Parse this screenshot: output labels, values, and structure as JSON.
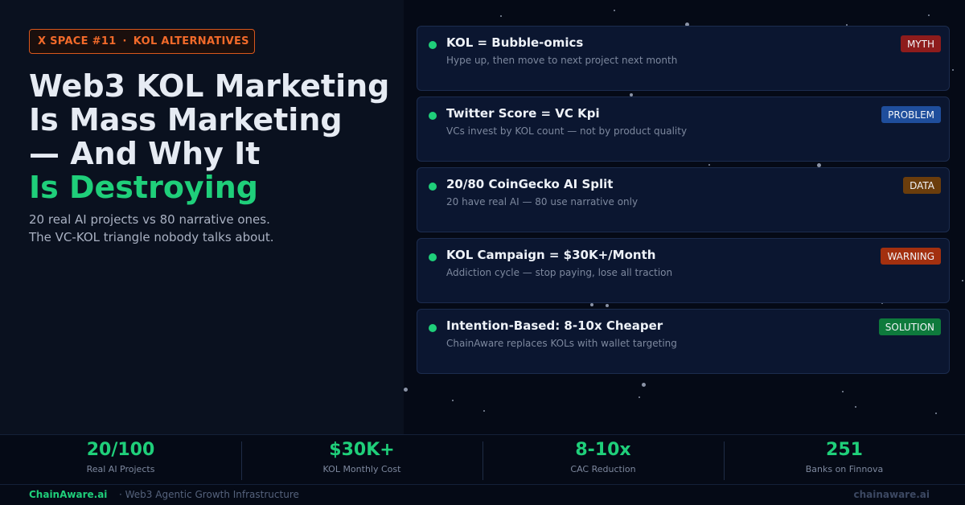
{
  "pill": {
    "left": "X SPACE #11",
    "separator": "·",
    "right": "KOL ALTERNATIVES"
  },
  "headline": {
    "line1": "Web3 KOL Marketing",
    "line2": "Is Mass Marketing",
    "line3": "— And Why It",
    "line4": "Is Destroying"
  },
  "subtext": {
    "line1": "20 real AI projects vs 80 narrative ones.",
    "line2": "The VC-KOL triangle nobody talks about."
  },
  "cards": [
    {
      "title": "KOL = Bubble-omics",
      "desc": "Hype up, then move to next project next month",
      "badge": "MYTH",
      "badge_color": "#8e1c1c"
    },
    {
      "title": "Twitter Score = VC Kpi",
      "desc": "VCs invest by KOL count — not by product quality",
      "badge": "PROBLEM",
      "badge_color": "#1f4e9c"
    },
    {
      "title": "20/80 CoinGecko AI Split",
      "desc": "20 have real AI — 80 use narrative only",
      "badge": "DATA",
      "badge_color": "#6b3d0c"
    },
    {
      "title": "KOL Campaign = $30K+/Month",
      "desc": "Addiction cycle — stop paying, lose all traction",
      "badge": "WARNING",
      "badge_color": "#a3300f"
    },
    {
      "title": "Intention-Based: 8-10x Cheaper",
      "desc": "ChainAware replaces KOLs with wallet targeting",
      "badge": "SOLUTION",
      "badge_color": "#0e7a3c"
    }
  ],
  "stats": [
    {
      "value": "20/100",
      "label": "Real AI Projects"
    },
    {
      "value": "$30K+",
      "label": "KOL Monthly Cost"
    },
    {
      "value": "8-10x",
      "label": "CAC Reduction"
    },
    {
      "value": "251",
      "label": "Banks on Finnova"
    }
  ],
  "footer": {
    "brand": "ChainAware.ai",
    "tagline": "· Web3 Agentic Growth Infrastructure",
    "domain": "chainaware.ai"
  },
  "colors": {
    "accent": "#1fcf7a",
    "pill": "#f26a2a",
    "background": "#060b16"
  }
}
